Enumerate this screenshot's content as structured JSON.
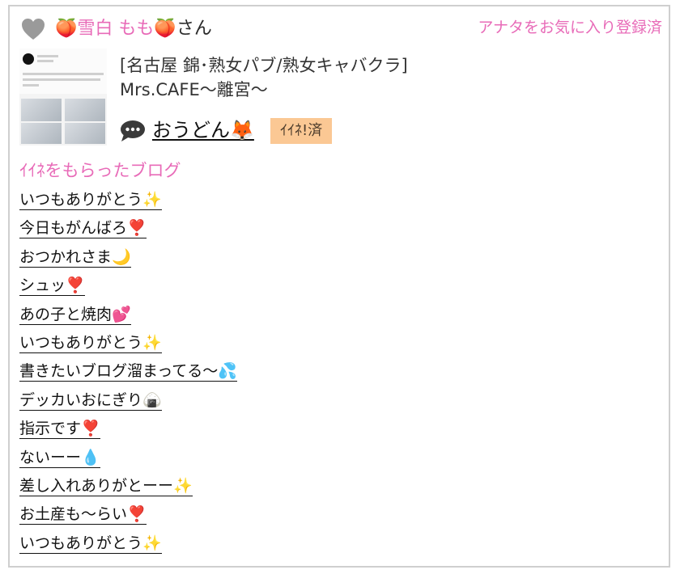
{
  "header": {
    "name_prefix_emoji": "🍑",
    "name": "雪白 もも",
    "name_suffix_emoji": "🍑",
    "honorific": "さん",
    "favorite_status": "アナタをお気に入り登録済"
  },
  "shop": {
    "category": "[名古屋 錦･熟女パブ/熟女キャバクラ]",
    "name": "Mrs.CAFE〜離宮〜"
  },
  "blogger": {
    "name": "おうどん🦊",
    "iine_label": "ｲｲﾈ!済"
  },
  "liked_blogs": {
    "title": "ｲｲﾈをもらったブログ",
    "items": [
      "いつもありがとう✨",
      "今日もがんばろ❣️",
      "おつかれさま🌙",
      "シュッ❣️",
      "あの子と焼肉💕",
      "いつもありがとう✨",
      "書きたいブログ溜まってる〜💦",
      "デッカいおにぎり🍙",
      "指示です❣️",
      "ないーー💧",
      "差し入れありがとーー✨",
      "お土産も〜らい❣️",
      "いつもありがとう✨"
    ]
  },
  "colors": {
    "accent_pink": "#e86bb8",
    "badge_bg": "#fbc894",
    "border": "#cfcfcf",
    "heart_gray": "#9a9a9a"
  },
  "icons": {
    "heart": "heart-icon",
    "speech": "speech-bubble-icon"
  }
}
